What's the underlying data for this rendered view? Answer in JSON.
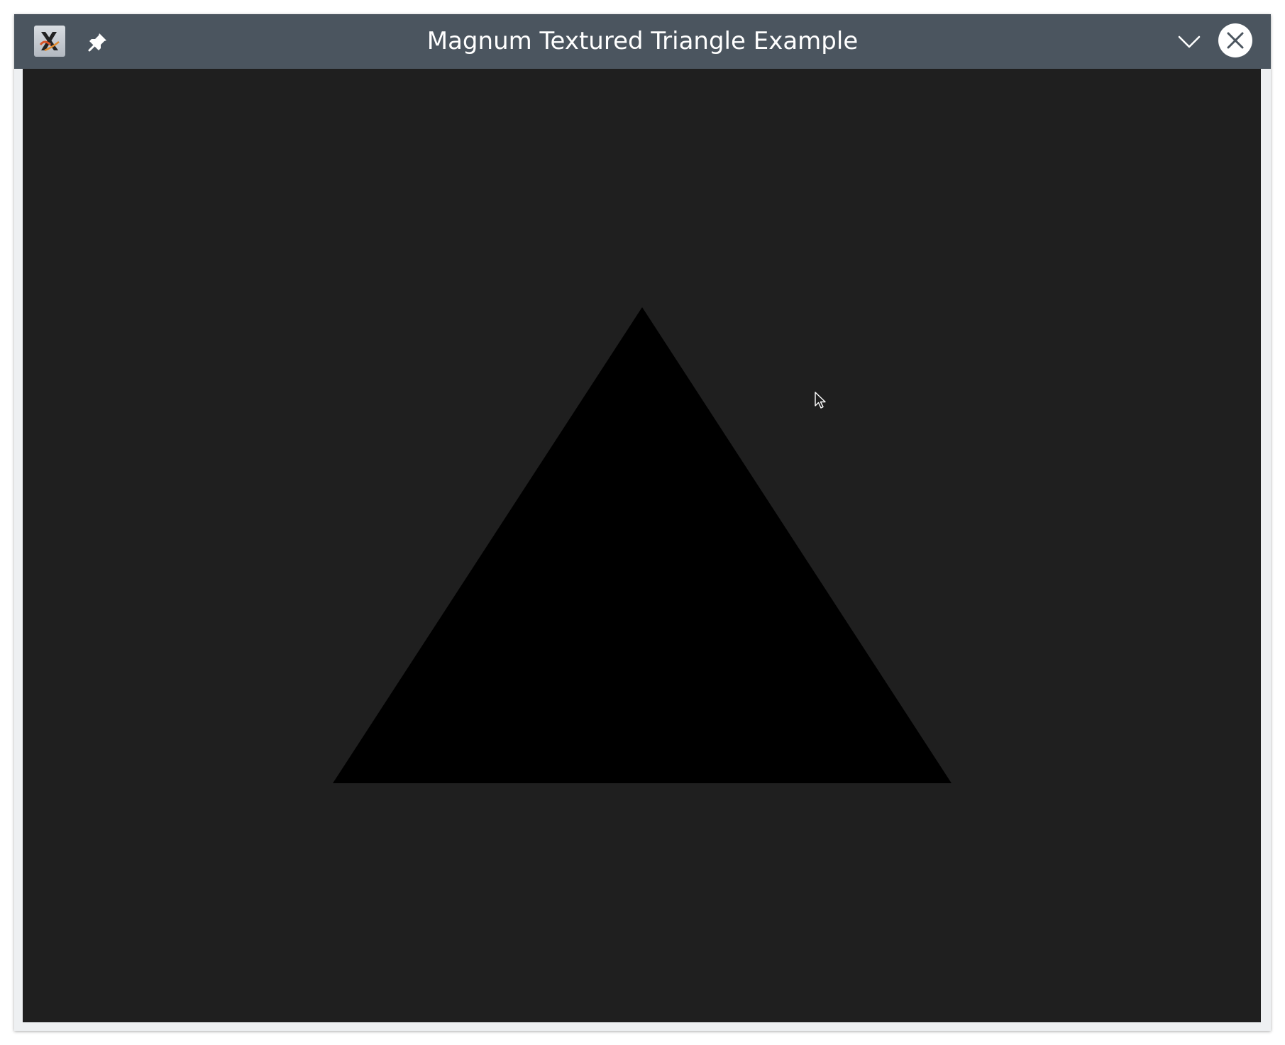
{
  "window": {
    "title": "Magnum Textured Triangle Example"
  },
  "titlebar": {
    "app_icon": "x11-app-icon",
    "pin_icon": "pin-icon",
    "menu_icon": "chevron-down-icon",
    "close_icon": "close-icon"
  },
  "viewport": {
    "background_color": "#1f1f1f",
    "shape": "triangle",
    "shape_color": "#000000",
    "cursor_icon": "mouse-pointer-icon"
  }
}
